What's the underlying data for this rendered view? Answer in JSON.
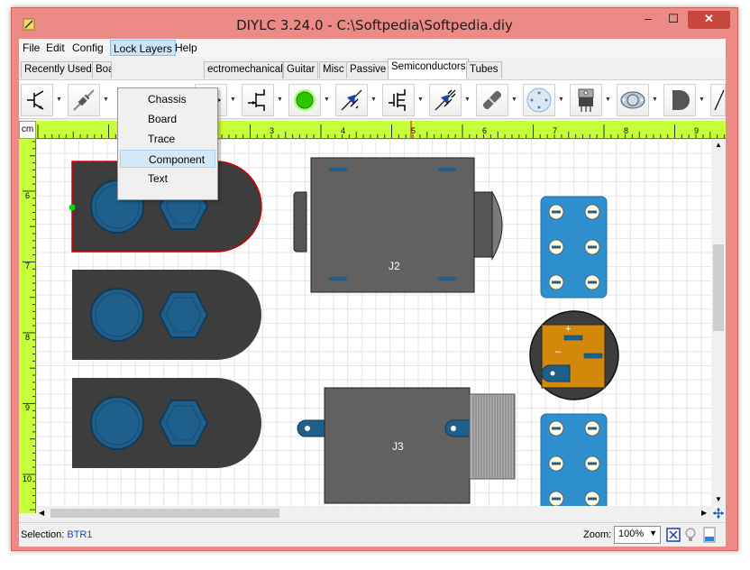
{
  "window": {
    "title": "DIYLC 3.24.0 - C:\\Softpedia\\Softpedia.diy",
    "min": "–",
    "max": "☐",
    "close": "✕"
  },
  "menu": [
    {
      "label": "File"
    },
    {
      "label": "Edit"
    },
    {
      "label": "Config"
    },
    {
      "label": "Lock Layers",
      "active": true
    },
    {
      "label": "Help"
    }
  ],
  "dropdown": [
    "Chassis",
    "Board",
    "Trace",
    "Component",
    "Text"
  ],
  "dropdown_hover_index": 3,
  "tabs": [
    {
      "label": "Recently Used"
    },
    {
      "label": "Boa"
    },
    {
      "label": "ectromechanical"
    },
    {
      "label": "Guitar"
    },
    {
      "label": "Misc"
    },
    {
      "label": "Passive"
    },
    {
      "label": "Semiconductors",
      "selected": true
    },
    {
      "label": "Tubes"
    }
  ],
  "toolbar_icons": [
    "transistor-icon",
    "diode-icon",
    "icon",
    "opamp-icon",
    "jfet-icon",
    "led-icon",
    "zener-diode-icon",
    "mosfet-icon",
    "photo-transistor-icon",
    "diode-glass-icon",
    "bridge-rectifier-icon",
    "to220-regulator-icon",
    "to3-transistor-icon",
    "to92-transistor-icon"
  ],
  "ruler": {
    "unit": "cm",
    "h_labels": [
      "1",
      "2",
      "3",
      "4",
      "5",
      "6",
      "7",
      "8",
      "9"
    ],
    "v_labels": [
      "6",
      "7",
      "8",
      "9",
      "10"
    ]
  },
  "canvas_labels": {
    "j2": "J2",
    "j3": "J3",
    "plus": "+",
    "minus": "–"
  },
  "status": {
    "selection_label": "Selection:",
    "selection_value": "BTR1",
    "zoom_label": "Zoom:",
    "zoom_value": "100%"
  },
  "colors": {
    "ruler": "#c7ff3a",
    "jack_body": "#3d3d3d",
    "jack_ring": "#1f5f8c",
    "component_gray": "#616161",
    "board_blue": "#2e8fcf",
    "cap_orange": "#d4880a",
    "selection_outline": "#d20000"
  }
}
